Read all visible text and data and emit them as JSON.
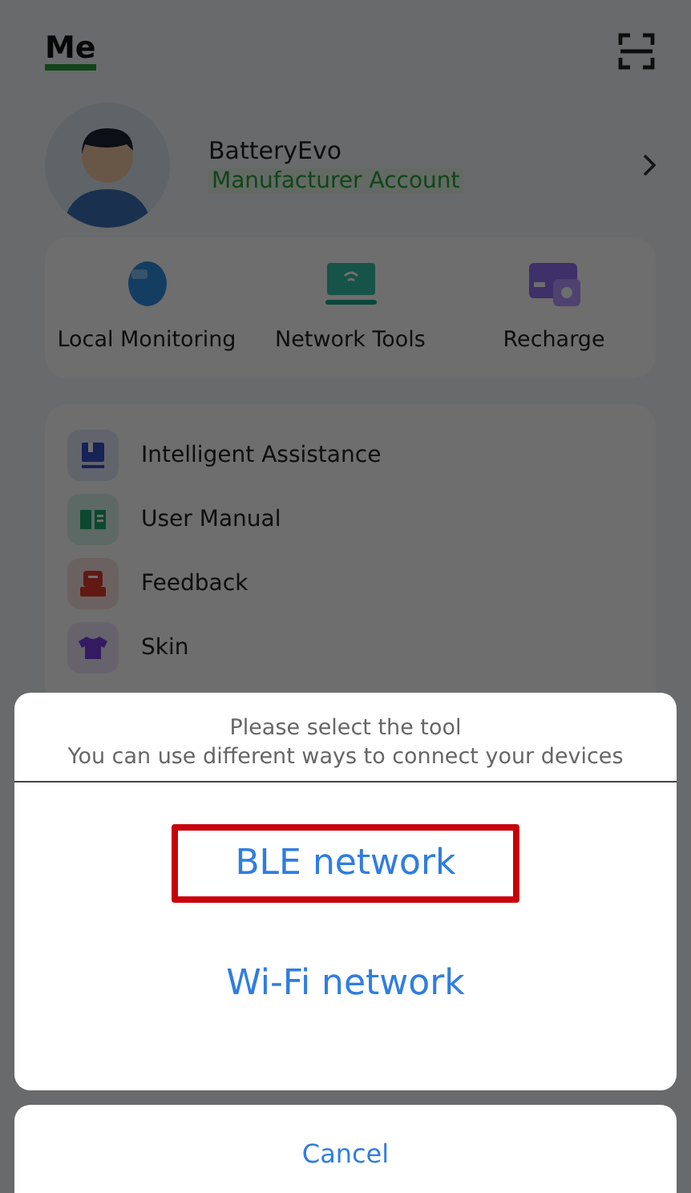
{
  "header": {
    "title": "Me"
  },
  "profile": {
    "name": "BatteryEvo",
    "role": "Manufacturer Account"
  },
  "quick_actions": [
    {
      "kind": "monitor",
      "label": "Local Monitoring"
    },
    {
      "kind": "network",
      "label": "Network Tools"
    },
    {
      "kind": "card",
      "label": "Recharge"
    }
  ],
  "menu": [
    {
      "kind": "assist",
      "label": "Intelligent Assistance"
    },
    {
      "kind": "manual",
      "label": "User Manual"
    },
    {
      "kind": "feedback",
      "label": "Feedback"
    },
    {
      "kind": "skin",
      "label": "Skin"
    }
  ],
  "sheet": {
    "title": "Please select the tool",
    "subtitle": "You can use different ways to connect your devices",
    "options": [
      {
        "label": "BLE network",
        "highlighted": true
      },
      {
        "label": "Wi-Fi network",
        "highlighted": false
      }
    ],
    "cancel": "Cancel"
  }
}
